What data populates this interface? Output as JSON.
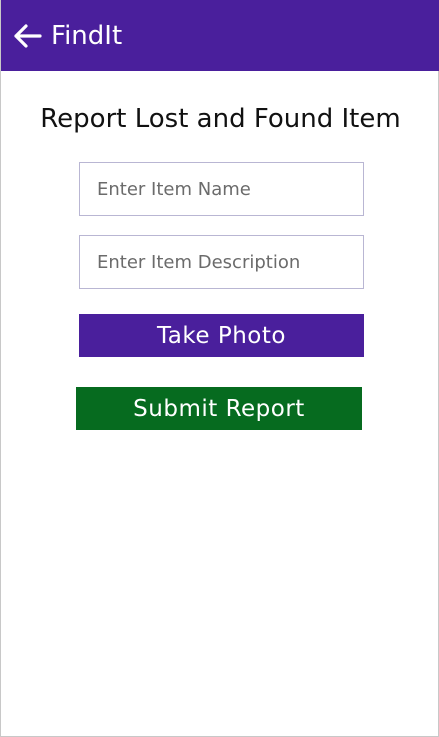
{
  "appbar": {
    "back_icon": "arrow-left-icon",
    "title": "FindIt",
    "background": "#4a1f9c"
  },
  "form": {
    "heading": "Report Lost and Found Item",
    "item_name": {
      "placeholder": "Enter Item Name",
      "value": ""
    },
    "item_description": {
      "placeholder": "Enter Item Description",
      "value": ""
    },
    "take_photo_label": "Take Photo",
    "submit_label": "Submit Report"
  },
  "colors": {
    "primary": "#4a1f9c",
    "success": "#066b1f",
    "field_border": "#b9b6d3"
  }
}
